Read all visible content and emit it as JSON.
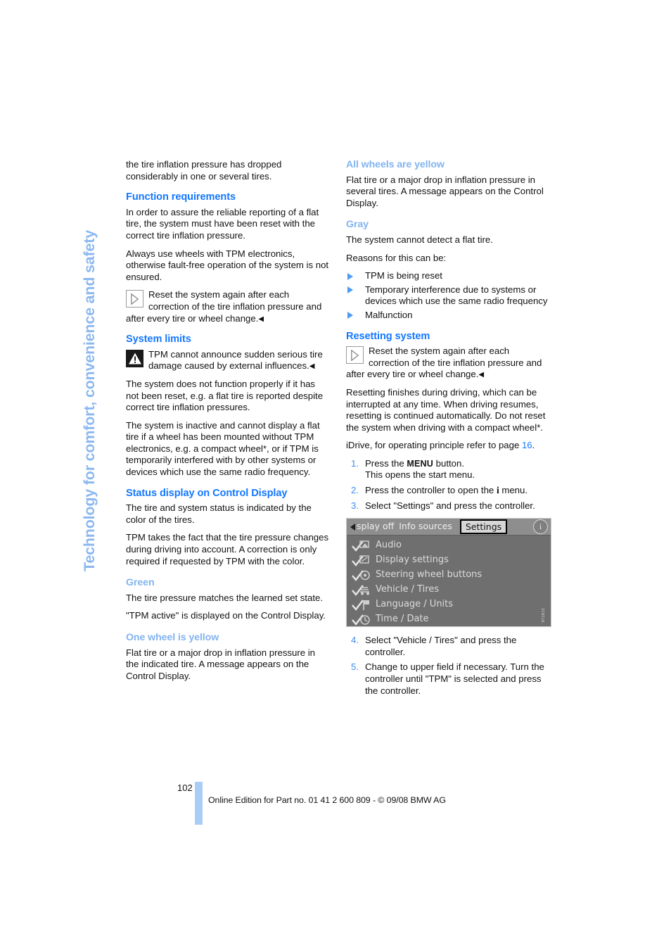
{
  "chapter_tab": "Technology for comfort, convenience and safety",
  "left_column": {
    "intro_paragraph": "the tire inflation pressure has dropped considerably in one or several tires.",
    "function_requirements": {
      "heading": "Function requirements",
      "p1": "In order to assure the reliable reporting of a flat tire, the system must have been reset with the correct tire inflation pressure.",
      "p2": "Always use wheels with TPM electronics, otherwise fault-free operation of the system is not ensured.",
      "note": "Reset the system again after each correction of the tire inflation pressure and after every tire or wheel change."
    },
    "system_limits": {
      "heading": "System limits",
      "warning": "TPM cannot announce sudden serious tire damage caused by external influences.",
      "p1": "The system does not function properly if it has not been reset, e.g. a flat tire is reported despite correct tire inflation pressures.",
      "p2_a": "The system is inactive and cannot display a flat tire if a wheel has been mounted without TPM electronics, e.g. a compact wheel",
      "p2_star": "*",
      "p2_b": ", or if TPM is temporarily interfered with by other systems or devices which use the same radio frequency."
    },
    "status_display": {
      "heading": "Status display on Control Display",
      "p1": "The tire and system status is indicated by the color of the tires.",
      "p2": "TPM takes the fact that the tire pressure changes during driving into account. A correction is only required if requested by TPM with the color."
    },
    "green": {
      "heading": "Green",
      "p1": "The tire pressure matches the learned set state.",
      "p2": "\"TPM active\" is displayed on the Control Display."
    },
    "one_wheel_yellow": {
      "heading": "One wheel is yellow",
      "p1": "Flat tire or a major drop in inflation pressure in the indicated tire. A message appears on the Control Display."
    }
  },
  "right_column": {
    "all_wheels_yellow": {
      "heading": "All wheels are yellow",
      "p1": "Flat tire or a major drop in inflation pressure in several tires. A message appears on the Control Display."
    },
    "gray": {
      "heading": "Gray",
      "p1": "The system cannot detect a flat tire.",
      "p2": "Reasons for this can be:",
      "bullets": [
        "TPM is being reset",
        "Temporary interference due to systems or devices which use the same radio frequency",
        "Malfunction"
      ]
    },
    "resetting_system": {
      "heading": "Resetting system",
      "note": "Reset the system again after each correction of the tire inflation pressure and after every tire or wheel change.",
      "p1_a": "Resetting finishes during driving, which can be interrupted at any time. When driving resumes, resetting is continued automatically. Do not reset the system when driving with a compact wheel",
      "p1_star": "*",
      "p1_b": ".",
      "idrive_ref_pre": "iDrive, for operating principle refer to page ",
      "idrive_ref_page": "16",
      "idrive_ref_post": ".",
      "steps": [
        {
          "num": "1.",
          "text_a": "Press the ",
          "kbd": "MENU",
          "text_b": " button.",
          "line2": "This opens the start menu."
        },
        {
          "num": "2.",
          "text_a": "Press the controller to open the ",
          "glyph": "i",
          "text_b": " menu."
        },
        {
          "num": "3.",
          "text_a": "Select \"Settings\" and press the controller.",
          "kbd": "",
          "text_b": ""
        }
      ],
      "steps_after": [
        {
          "num": "4.",
          "text": "Select \"Vehicle / Tires\" and press the controller."
        },
        {
          "num": "5.",
          "text": "Change to upper field if necessary. Turn the controller until \"TPM\" is selected and press the controller."
        }
      ]
    }
  },
  "idrive_screenshot": {
    "tabs": [
      {
        "label": "splay off",
        "selected": false
      },
      {
        "label": "Info sources",
        "selected": false
      },
      {
        "label": "Settings",
        "selected": true
      }
    ],
    "info_badge": "i",
    "menu_items": [
      "Audio",
      "Display settings",
      "Steering wheel buttons",
      "Vehicle / Tires",
      "Language / Units",
      "Time / Date"
    ],
    "watermark": "N71B10"
  },
  "footer": {
    "page_number": "102",
    "text": "Online Edition for Part no. 01 41 2 600 809 - © 09/08 BMW AG"
  },
  "colors": {
    "heading_blue": "#1478FF",
    "subheading_blue": "#82B4F0",
    "tab_blue": "#8CB8F0",
    "footer_bar_blue": "#aacdf5",
    "bullet_blue": "#4d9bf5"
  }
}
